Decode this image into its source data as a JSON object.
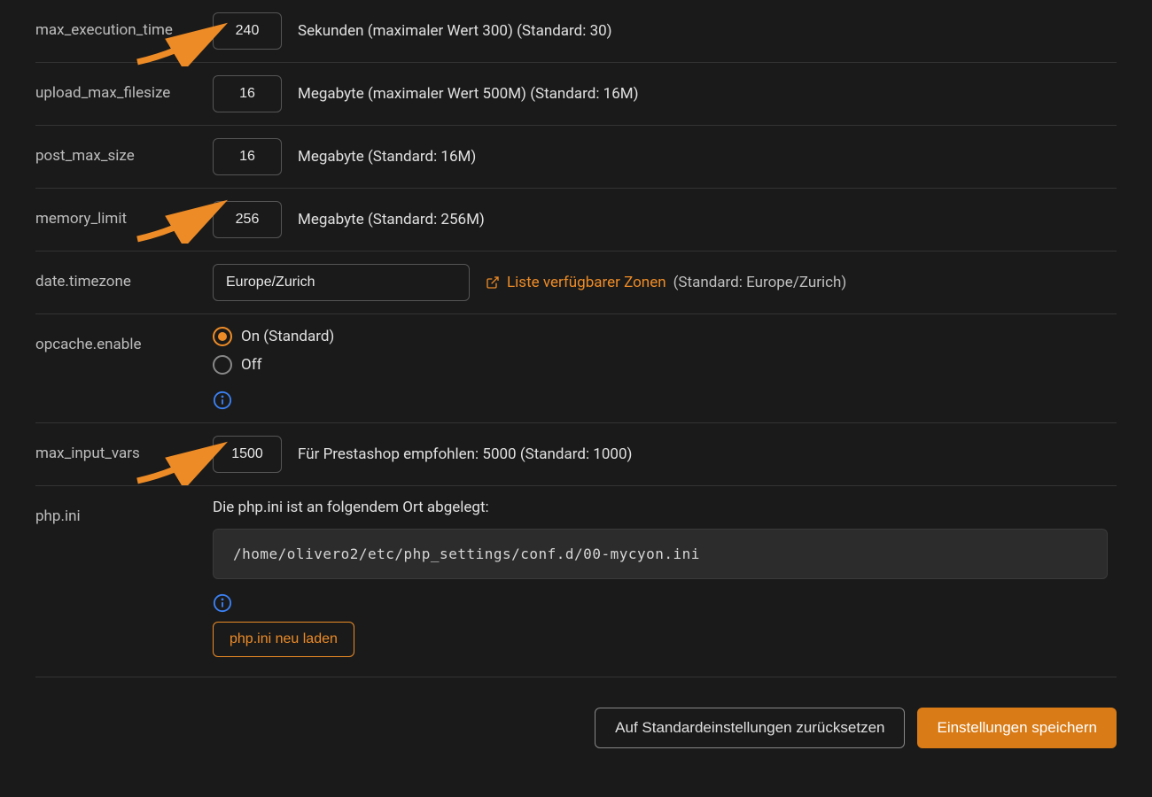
{
  "settings": {
    "max_execution_time": {
      "label": "max_execution_time",
      "value": "240",
      "hint": "Sekunden (maximaler Wert 300) (Standard: 30)"
    },
    "upload_max_filesize": {
      "label": "upload_max_filesize",
      "value": "16",
      "hint": "Megabyte (maximaler Wert 500M) (Standard: 16M)"
    },
    "post_max_size": {
      "label": "post_max_size",
      "value": "16",
      "hint": "Megabyte (Standard: 16M)"
    },
    "memory_limit": {
      "label": "memory_limit",
      "value": "256",
      "hint": "Megabyte (Standard: 256M)"
    },
    "date_timezone": {
      "label": "date.timezone",
      "value": "Europe/Zurich",
      "link": "Liste verfügbarer Zonen",
      "suffix": "(Standard: Europe/Zurich)"
    },
    "opcache_enable": {
      "label": "opcache.enable",
      "on": "On (Standard)",
      "off": "Off",
      "selected": "on"
    },
    "max_input_vars": {
      "label": "max_input_vars",
      "value": "1500",
      "hint": "Für Prestashop empfohlen: 5000 (Standard: 1000)"
    },
    "phpini": {
      "label": "php.ini",
      "desc": "Die php.ini ist an folgendem Ort abgelegt:",
      "path": "/home/olivero2/etc/php_settings/conf.d/00-mycyon.ini",
      "reload": "php.ini neu laden"
    }
  },
  "footer": {
    "reset": "Auf Standardeinstellungen zurücksetzen",
    "save": "Einstellungen speichern"
  }
}
